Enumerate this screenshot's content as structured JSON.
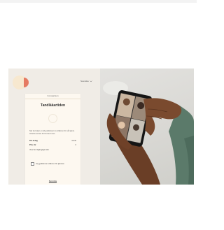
{
  "header": {
    "logo_icon": "logo-icon",
    "language_label": "Svenska",
    "language_icon": "chevron-down-icon"
  },
  "card": {
    "provider": "Comparison",
    "title": "Tandläkartiden",
    "description": "När du bokar en tid godkänner du villkoren för vår tjänst. Avboka senast 24 timmar innan.",
    "rows": [
      {
        "label": "Tid & dag",
        "value": "09:30"
      },
      {
        "label": "Pris / kr",
        "value": "0"
      }
    ],
    "link_label": "Visa fler tillgängliga tider",
    "checkbox_label": "Jag godkänner villkoren för tjänsten",
    "submit_label": "Bekräfta"
  },
  "colors": {
    "accent": "#e57a62",
    "logo_pale": "#f7e8cf",
    "card_bg": "#fdf8f0"
  },
  "photo": {
    "subject": "hands-holding-phone-video-call"
  }
}
